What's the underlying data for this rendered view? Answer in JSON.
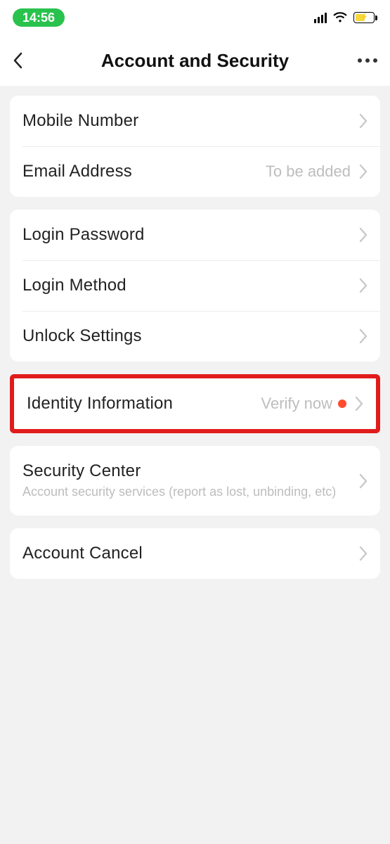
{
  "statusbar": {
    "time": "14:56"
  },
  "navbar": {
    "title": "Account and Security"
  },
  "groups": [
    {
      "id": "contact",
      "rows": [
        {
          "id": "mobile",
          "label": "Mobile Number",
          "value": ""
        },
        {
          "id": "email",
          "label": "Email Address",
          "value": "To be added"
        }
      ]
    },
    {
      "id": "login",
      "rows": [
        {
          "id": "login-password",
          "label": "Login Password"
        },
        {
          "id": "login-method",
          "label": "Login Method"
        },
        {
          "id": "unlock-settings",
          "label": "Unlock Settings"
        }
      ]
    },
    {
      "id": "identity",
      "highlighted": true,
      "rows": [
        {
          "id": "identity-info",
          "label": "Identity Information",
          "value": "Verify now",
          "badge": true
        }
      ]
    },
    {
      "id": "security",
      "rows": [
        {
          "id": "security-center",
          "label": "Security Center",
          "sublabel": "Account security services (report as lost, unbinding, etc)"
        }
      ]
    },
    {
      "id": "account",
      "rows": [
        {
          "id": "account-cancel",
          "label": "Account Cancel"
        }
      ]
    }
  ]
}
